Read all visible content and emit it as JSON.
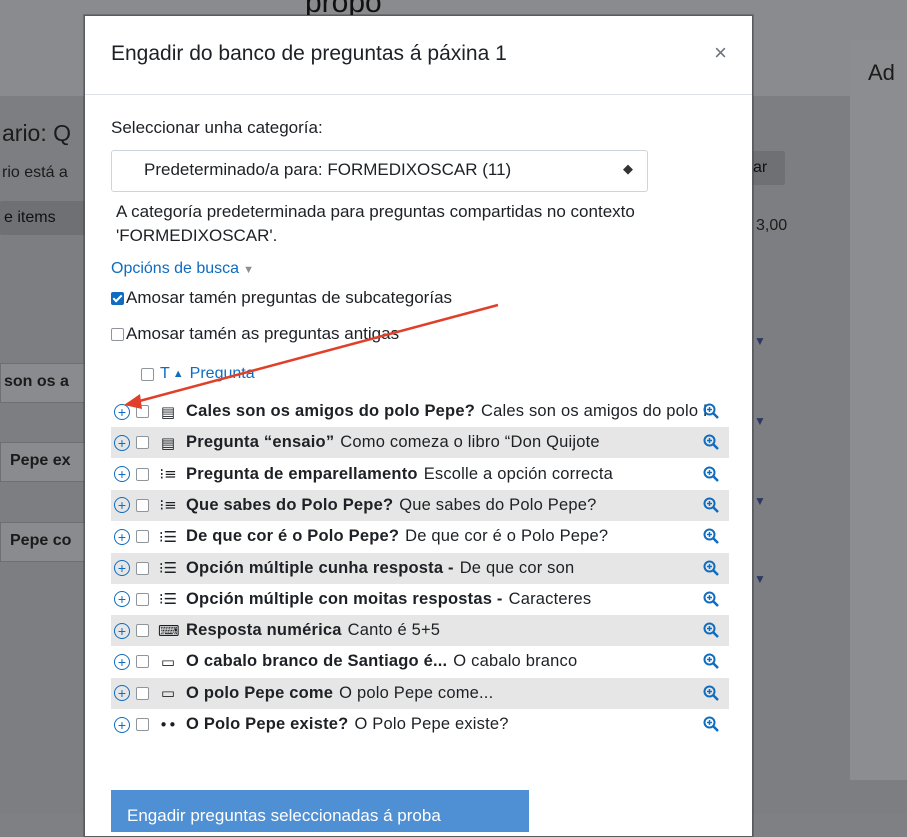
{
  "background": {
    "caption": "propó",
    "left_texts": [
      "ario: Q",
      "rio está a",
      "e items",
      "son os a",
      "Pepe ex",
      "Pepe co"
    ],
    "right_texts": [
      "ar",
      "3,00"
    ],
    "right_label": "Ad"
  },
  "modal": {
    "title": "Engadir do banco de preguntas á páxina 1",
    "close_label": "×",
    "category_label": "Seleccionar unha categoría:",
    "category_selected": "Predeterminado/a para: FORMEDIXOSCAR (11)",
    "category_description": "A categoría predeterminada para preguntas compartidas no contexto 'FORMEDIXOSCAR'.",
    "search_options_label": "Opcións de busca",
    "checkboxes": [
      {
        "label": "Amosar tamén preguntas de subcategorías",
        "checked": true
      },
      {
        "label": "Amosar tamén as preguntas antigas",
        "checked": false
      }
    ],
    "table_header": {
      "type_col": "T",
      "question_col": "Pregunta"
    },
    "questions": [
      {
        "name": "Cales son os amigos do polo Pepe?",
        "snippet": "Cales son os amigos do polo Pepe?",
        "type_icon": "essay-icon",
        "glyph": "▤"
      },
      {
        "name": "Pregunta “ensaio”",
        "snippet": "Como comeza o libro “Don Quijote",
        "type_icon": "essay-icon",
        "glyph": "▤"
      },
      {
        "name": "Pregunta de emparellamento",
        "snippet": "Escolle a opción correcta",
        "type_icon": "matching-icon",
        "glyph": "⁝≡"
      },
      {
        "name": "Que sabes do Polo Pepe?",
        "snippet": "Que sabes do Polo Pepe?",
        "type_icon": "matching-icon",
        "glyph": "⁝≡"
      },
      {
        "name": "De que cor é o Polo Pepe?",
        "snippet": "De que cor é o Polo Pepe?",
        "type_icon": "multichoice-icon",
        "glyph": "⁝☰"
      },
      {
        "name": "Opción múltiple cunha resposta -",
        "snippet": "De que cor son",
        "type_icon": "multichoice-icon",
        "glyph": "⁝☰"
      },
      {
        "name": "Opción múltiple con moitas respostas -",
        "snippet": "Caracteres",
        "type_icon": "multichoice-icon",
        "glyph": "⁝☰"
      },
      {
        "name": "Resposta numérica",
        "snippet": "Canto é  5+5",
        "type_icon": "numerical-icon",
        "glyph": "⌨"
      },
      {
        "name": "O cabalo branco de Santiago é...",
        "snippet": "O cabalo branco",
        "type_icon": "shortanswer-icon",
        "glyph": "▭"
      },
      {
        "name": "O polo Pepe come",
        "snippet": "O polo Pepe come...",
        "type_icon": "shortanswer-icon",
        "glyph": "▭"
      },
      {
        "name": "O Polo Pepe existe?",
        "snippet": "O Polo Pepe existe?",
        "type_icon": "truefalse-icon",
        "glyph": "••"
      }
    ],
    "submit_label": "Engadir preguntas seleccionadas á proba"
  },
  "colors": {
    "link": "#0f6cbf",
    "annotation_arrow": "#e0402a",
    "row_alt": "#e6e6e6"
  }
}
